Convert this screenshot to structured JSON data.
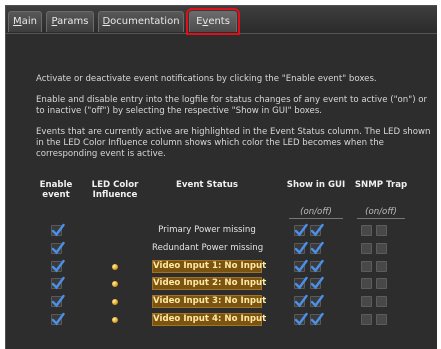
{
  "tabs": [
    {
      "label_pre": "M",
      "label_key": "",
      "label_post": "ain",
      "full": "Main",
      "active": false
    },
    {
      "label_pre": "",
      "label_key": "P",
      "label_post": "arams",
      "full": "Params",
      "active": false
    },
    {
      "label_pre": "",
      "label_key": "D",
      "label_post": "ocumentation",
      "full": "Documentation",
      "active": false
    },
    {
      "label_pre": "E",
      "label_key": "v",
      "label_post": "ents",
      "full": "Events",
      "active": true
    }
  ],
  "intro": [
    "Activate or deactivate event notifications by clicking the \"Enable event\" boxes.",
    "Enable and disable entry into the logfile for status changes of any event to active (\"on\") or to inactive (\"off\") by selecting the respective \"Show in GUI\" boxes.",
    "Events that are currently active are highlighted in the Event Status column. The LED shown in the LED Color Influence column shows which color the LED becomes when the corresponding event is active."
  ],
  "headers": {
    "enable": "Enable event",
    "led": "LED Color Influence",
    "status": "Event Status",
    "gui": "Show in GUI",
    "snmp": "SNMP Trap",
    "gui_sub": "(on/off)",
    "snmp_sub": "(on/off)"
  },
  "events": [
    {
      "name": "Primary Power missing",
      "active": false,
      "enabled": true,
      "led": false,
      "gui_on": true,
      "gui_off": true,
      "snmp_on": false,
      "snmp_off": false
    },
    {
      "name": "Redundant Power missing",
      "active": false,
      "enabled": true,
      "led": false,
      "gui_on": true,
      "gui_off": true,
      "snmp_on": false,
      "snmp_off": false
    },
    {
      "name": "Video Input 1: No Input",
      "active": true,
      "enabled": true,
      "led": true,
      "gui_on": true,
      "gui_off": true,
      "snmp_on": false,
      "snmp_off": false
    },
    {
      "name": "Video Input 2: No Input",
      "active": true,
      "enabled": true,
      "led": true,
      "gui_on": true,
      "gui_off": true,
      "snmp_on": false,
      "snmp_off": false
    },
    {
      "name": "Video Input 3: No Input",
      "active": true,
      "enabled": true,
      "led": true,
      "gui_on": true,
      "gui_off": true,
      "snmp_on": false,
      "snmp_off": false
    },
    {
      "name": "Video Input 4: No Input",
      "active": true,
      "enabled": true,
      "led": true,
      "gui_on": true,
      "gui_off": true,
      "snmp_on": false,
      "snmp_off": false
    }
  ],
  "colors": {
    "accent_checkmark": "#4a8fe8",
    "led_color": "#e0a020",
    "active_highlight": "#7a5410",
    "tab_focus_outline": "#e0101a"
  }
}
